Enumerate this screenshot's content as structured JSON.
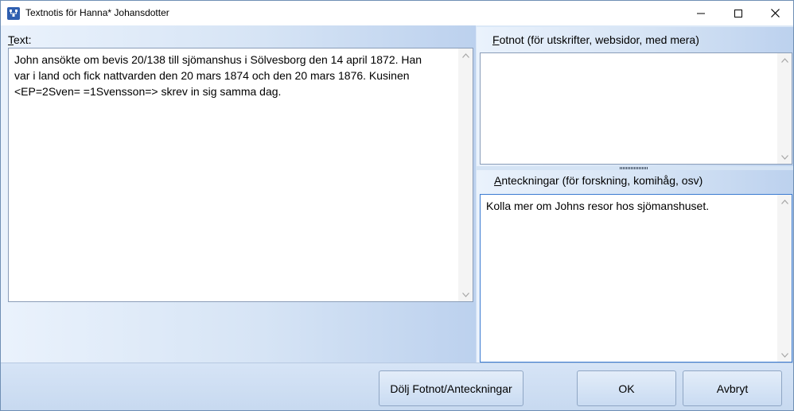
{
  "window": {
    "title": "Textnotis för Hanna* Johansdotter"
  },
  "text_section": {
    "label_mnemonic": "T",
    "label_rest": "ext:",
    "value": "John ansökte om bevis 20/138 till sjömanshus i Sölvesborg den 14 april 1872. Han\nvar i land och fick nattvarden den 20 mars 1874 och den 20 mars 1876. Kusinen\n<EP=2Sven= =1Svensson=> skrev in sig samma dag."
  },
  "footnote_section": {
    "label_mnemonic": "F",
    "label_rest": "otnot (för utskrifter, websidor, med mera)",
    "value": ""
  },
  "notes_section": {
    "label_mnemonic": "A",
    "label_rest": "nteckningar (för forskning, komihåg, osv)",
    "value": "Kolla mer om Johns resor hos sjömanshuset."
  },
  "buttons": {
    "toggle_label": "Dölj Fotnot/Anteckningar",
    "ok_label": "OK",
    "cancel_label": "Avbryt"
  },
  "icons": {
    "app": "family-tree-icon",
    "minimize": "minimize-icon",
    "maximize": "maximize-icon",
    "close": "close-icon",
    "scroll_up": "chevron-up-icon",
    "scroll_down": "chevron-down-icon"
  },
  "colors": {
    "focus_border": "#3b7bd1",
    "pane_gradient_light": "#eaf2fc",
    "pane_gradient_dark": "#bcd1ee"
  }
}
